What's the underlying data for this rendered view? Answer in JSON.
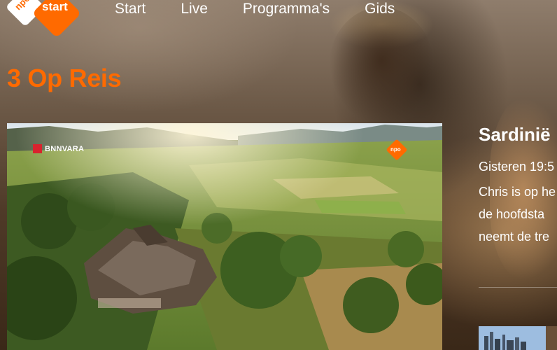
{
  "header": {
    "logo": {
      "npo": "npo",
      "start": "start"
    },
    "nav": [
      "Start",
      "Live",
      "Programma's",
      "Gids"
    ]
  },
  "page": {
    "title": "3 Op Reis"
  },
  "video": {
    "broadcaster": "BNNVARA",
    "channel_bug": "npo"
  },
  "episode": {
    "title": "Sardinië",
    "meta": "Gisteren 19:5",
    "description_lines": [
      "Chris is op he",
      "de hoofdsta",
      "neemt de tre"
    ]
  },
  "colors": {
    "accent": "#ff6a00",
    "broadcaster_red": "#d9232e"
  }
}
